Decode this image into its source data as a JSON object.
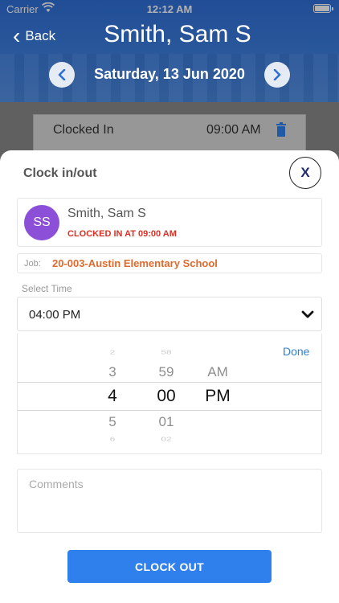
{
  "status_bar": {
    "carrier": "Carrier",
    "time": "12:12 AM"
  },
  "nav": {
    "back_label": "Back",
    "title": "Smith, Sam S"
  },
  "date_nav": {
    "date": "Saturday, 13 Jun 2020",
    "prev_icon": "chevron-left-icon",
    "next_icon": "chevron-right-icon"
  },
  "clocked_card": {
    "label": "Clocked In",
    "time": "09:00 AM",
    "icon": "trash-icon"
  },
  "sheet": {
    "title": "Clock in/out",
    "close_label": "X",
    "user": {
      "initials": "SS",
      "name": "Smith, Sam S",
      "status": "CLOCKED IN AT 09:00 AM"
    },
    "job": {
      "label": "Job:",
      "value": "20-003-Austin Elementary School"
    },
    "select_time": {
      "label": "Select Time",
      "value": "04:00 PM"
    },
    "picker": {
      "done_label": "Done",
      "hours": [
        "2",
        "3",
        "4",
        "5",
        "6"
      ],
      "minutes": [
        "58",
        "59",
        "00",
        "01",
        "02"
      ],
      "ampm": [
        "AM",
        "PM"
      ]
    },
    "comments_placeholder": "Comments",
    "clock_out_label": "CLOCK OUT"
  },
  "colors": {
    "header_blue": "#2f6fd6",
    "avatar": "#8b4fd8",
    "status_red": "#d93025",
    "job_orange": "#e06a2c",
    "button_blue": "#2f80ed"
  }
}
